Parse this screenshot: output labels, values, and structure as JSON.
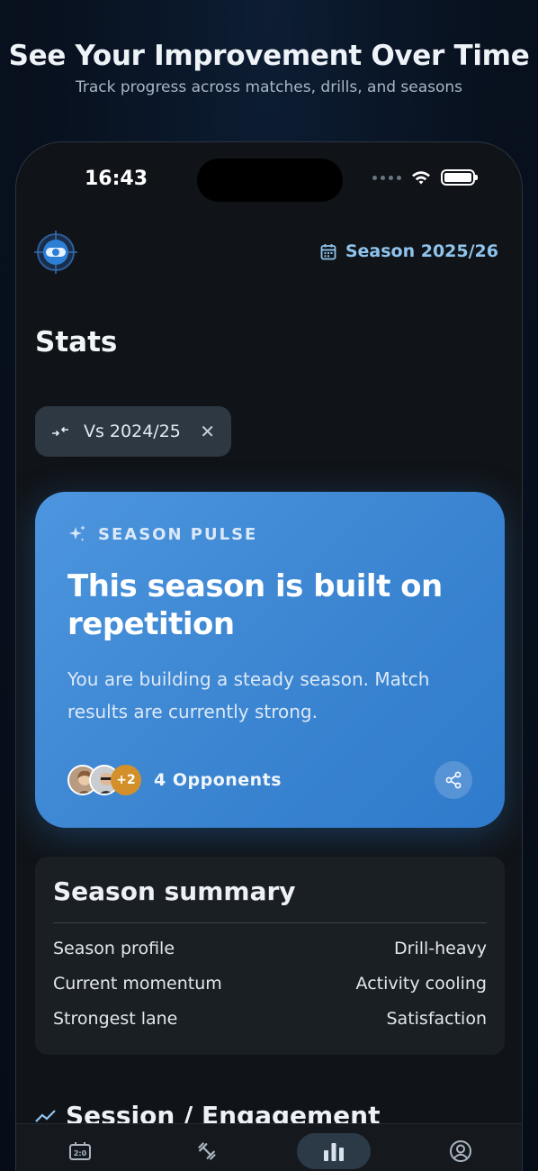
{
  "promo": {
    "title": "See Your Improvement Over Time",
    "subtitle": "Track progress across matches, drills, and seasons"
  },
  "status_bar": {
    "time": "16:43"
  },
  "header": {
    "logo_icon": "target-logo-icon",
    "season_icon": "calendar-icon",
    "season_label": "Season 2025/26"
  },
  "page": {
    "title": "Stats"
  },
  "compare_chip": {
    "icon": "compare-arrows-icon",
    "label": "Vs 2024/25",
    "close_glyph": "✕"
  },
  "season_pulse": {
    "label": "SEASON PULSE",
    "headline": "This season is built on repetition",
    "body": "You are building a steady season. Match results are currently strong.",
    "extra_opponents": "+2",
    "opponents_label": "4 Opponents",
    "share_icon": "share-icon",
    "accent": "#3c86d2"
  },
  "season_summary": {
    "title": "Season summary",
    "rows": [
      {
        "label": "Season profile",
        "value": "Drill-heavy"
      },
      {
        "label": "Current momentum",
        "value": "Activity cooling"
      },
      {
        "label": "Strongest lane",
        "value": "Satisfaction"
      }
    ]
  },
  "section": {
    "icon": "trend-line-icon",
    "title": "Session / Engagement"
  },
  "tabbar": {
    "tabs": [
      {
        "name": "scoreboard-icon",
        "active": false
      },
      {
        "name": "dumbbell-icon",
        "active": false
      },
      {
        "name": "bar-chart-icon",
        "active": true
      },
      {
        "name": "profile-icon",
        "active": false
      }
    ]
  }
}
